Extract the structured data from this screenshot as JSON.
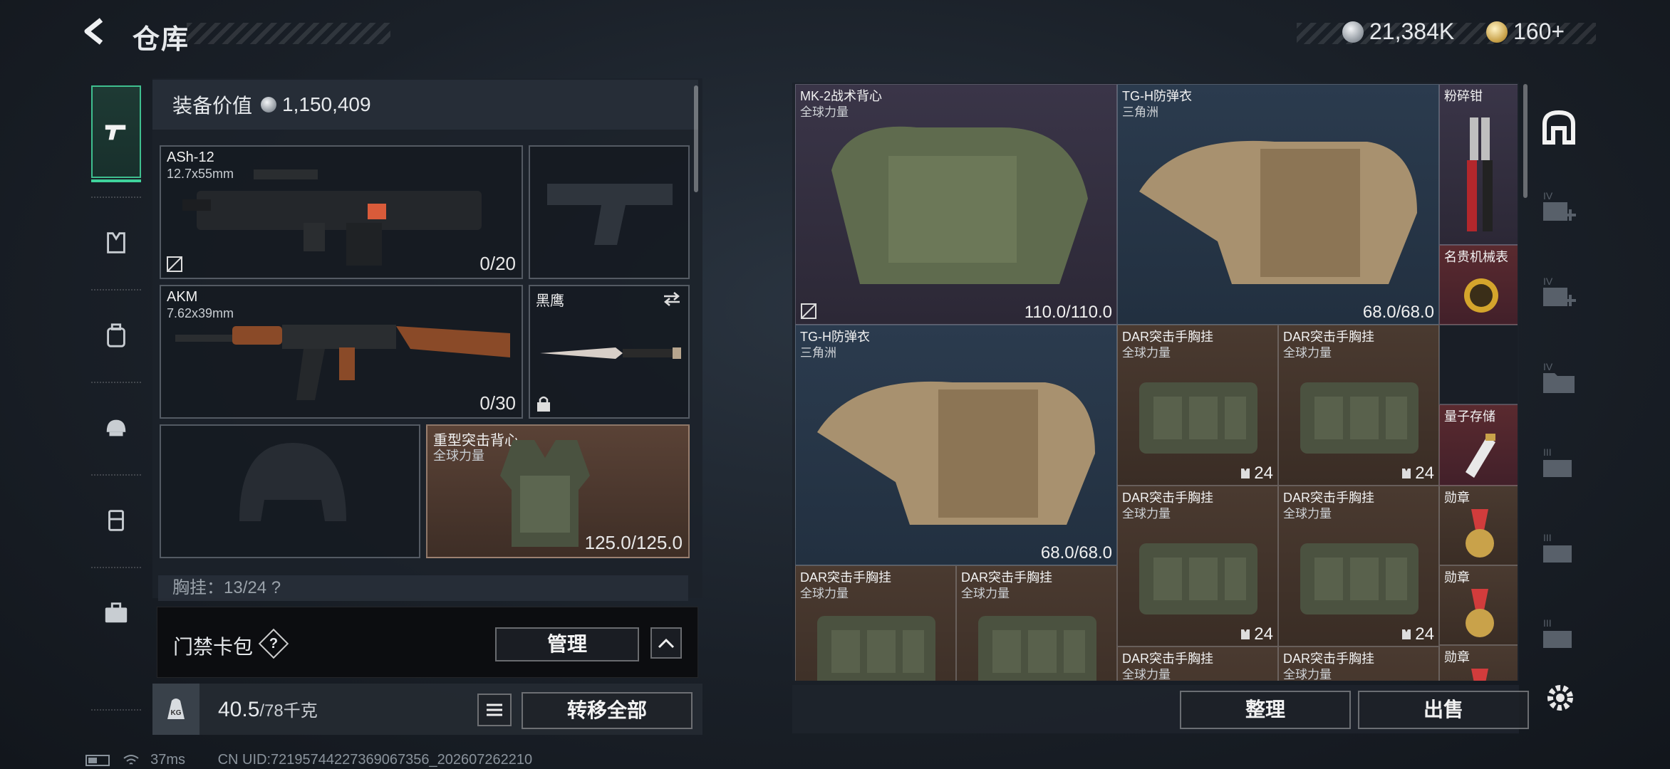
{
  "header": {
    "title": "仓库",
    "silver_amount": "21,384K",
    "gold_amount": "160+"
  },
  "sidebar": {
    "items": [
      {
        "id": "weapons",
        "icon": "pistol-icon",
        "active": true
      },
      {
        "id": "vest",
        "icon": "vest-icon"
      },
      {
        "id": "backpack",
        "icon": "backpack-icon"
      },
      {
        "id": "helmet",
        "icon": "helmet-icon"
      },
      {
        "id": "chest",
        "icon": "chest-rig-icon"
      },
      {
        "id": "case",
        "icon": "briefcase-icon"
      }
    ]
  },
  "equipment": {
    "value_label": "装备价值",
    "value": "1,150,409",
    "slots": [
      {
        "name": "ASh-12",
        "sub": "12.7x55mm",
        "count": "0/20"
      },
      {
        "name": "",
        "sub": "",
        "count": ""
      },
      {
        "name": "AKM",
        "sub": "7.62x39mm",
        "count": "0/30"
      },
      {
        "name": "黑鹰",
        "sub": "",
        "count": ""
      },
      {
        "name": "",
        "sub": "",
        "count": ""
      },
      {
        "name": "重型突击背心",
        "sub": "全球力量",
        "count": "125.0/125.0"
      }
    ],
    "chest_row": "胸挂：13/24 ?",
    "keycard_label": "门禁卡包",
    "help_symbol": "?",
    "manage_label": "管理",
    "weight_value": "40.5",
    "weight_max": "/78千克",
    "transfer_all_label": "转移全部"
  },
  "stash": {
    "items": [
      {
        "name": "MK-2战术背心",
        "sub": "全球力量",
        "value": "110.0/110.0"
      },
      {
        "name": "TG-H防弹衣",
        "sub": "三角洲",
        "value": "68.0/68.0"
      },
      {
        "name": "粉碎钳",
        "sub": "",
        "value": ""
      },
      {
        "name": "名贵机械表",
        "sub": "",
        "value": ""
      },
      {
        "name": "TG-H防弹衣",
        "sub": "三角洲",
        "value": "68.0/68.0"
      },
      {
        "name": "DAR突击手胸挂",
        "sub": "全球力量",
        "cap": "24"
      },
      {
        "name": "DAR突击手胸挂",
        "sub": "全球力量",
        "cap": "24"
      },
      {
        "name": "量子存储",
        "sub": "",
        "value": ""
      },
      {
        "name": "DAR突击手胸挂",
        "sub": "全球力量",
        "cap": "24"
      },
      {
        "name": "DAR突击手胸挂",
        "sub": "全球力量",
        "cap": "24"
      },
      {
        "name": "勋章",
        "sub": "",
        "value": ""
      },
      {
        "name": "勋章",
        "sub": "",
        "value": ""
      },
      {
        "name": "DAR突击手胸挂",
        "sub": "全球力量",
        "value": ""
      },
      {
        "name": "DAR突击手胸挂",
        "sub": "全球力量",
        "value": ""
      },
      {
        "name": "DAR突击手胸挂",
        "sub": "全球力量",
        "value": ""
      },
      {
        "name": "DAR突击手胸挂",
        "sub": "全球力量",
        "value": ""
      },
      {
        "name": "勋章",
        "sub": "",
        "value": ""
      }
    ],
    "sort_label": "整理",
    "sell_label": "出售"
  },
  "status": {
    "ping": "37ms",
    "uid": "CN UID:72195744227369067356_202607262210"
  },
  "colors": {
    "accent_green": "#3fd39c",
    "slot_brown": "#5a4236",
    "slot_purple": "#3a3548",
    "slot_blue": "#2b3b4e",
    "slot_red": "#5a2a2f"
  }
}
